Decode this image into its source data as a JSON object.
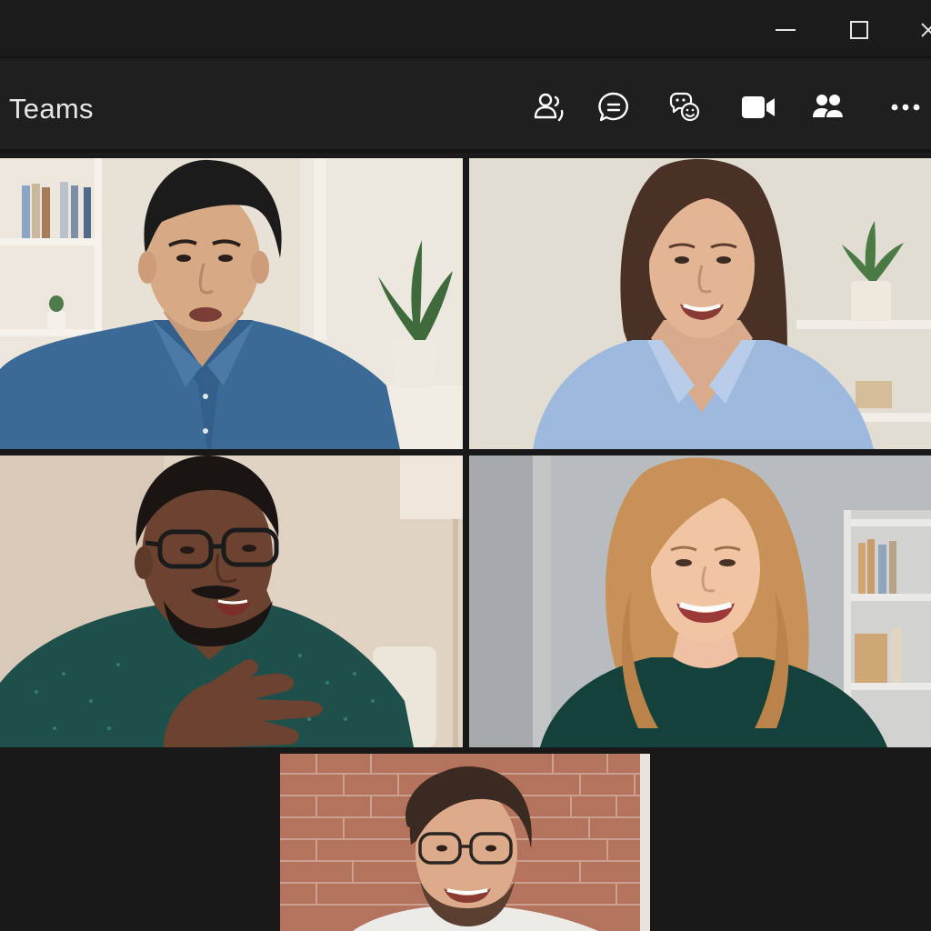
{
  "window": {
    "minimize_icon": "minimize-icon",
    "maximize_icon": "maximize-icon",
    "close_icon": "close-icon"
  },
  "toolbar": {
    "app_title": "Teams",
    "buttons": [
      {
        "icon": "people-icon"
      },
      {
        "icon": "chat-icon"
      },
      {
        "icon": "reactions-icon"
      },
      {
        "icon": "camera-icon"
      },
      {
        "icon": "breakout-rooms-icon"
      },
      {
        "icon": "more-options-icon"
      }
    ]
  },
  "participants": [
    {
      "tile": 1
    },
    {
      "tile": 2
    },
    {
      "tile": 3
    },
    {
      "tile": 4
    },
    {
      "tile": 5
    }
  ],
  "colors": {
    "background": "#1b1b1b",
    "toolbar": "#1f1f1f",
    "icon": "#ffffff"
  }
}
